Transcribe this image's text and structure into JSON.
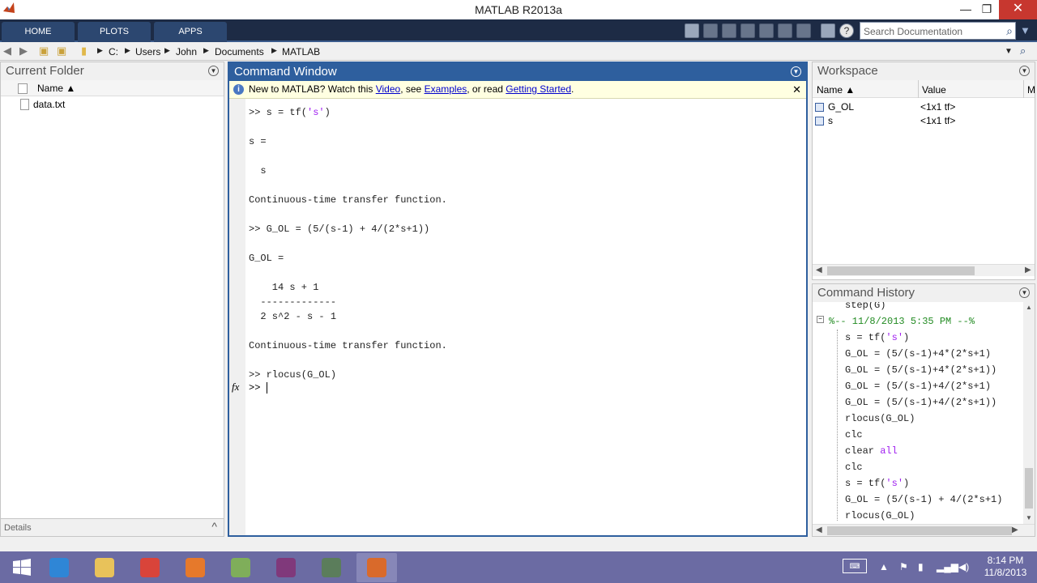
{
  "window": {
    "title": "MATLAB R2013a",
    "min": "—",
    "restore": "❐",
    "close": "✕"
  },
  "toolstrip": {
    "tabs": [
      "HOME",
      "PLOTS",
      "APPS"
    ],
    "search_placeholder": "Search Documentation",
    "accent": "#2e5f9e"
  },
  "address": {
    "path": [
      "C:",
      "Users",
      "John",
      "Documents",
      "MATLAB"
    ]
  },
  "current_folder": {
    "title": "Current Folder",
    "column": "Name ▲",
    "files": [
      "data.txt"
    ],
    "details_label": "Details"
  },
  "command_window": {
    "title": "Command Window",
    "banner": {
      "prefix": "New to MATLAB? Watch this ",
      "video": "Video",
      "mid": ", see ",
      "examples": "Examples",
      "mid2": ", or read ",
      "getting_started": "Getting Started",
      "suffix": "."
    },
    "lines": [
      {
        "pre": ">> s = tf(",
        "str": "'s'",
        "post": ")"
      },
      {
        "pre": "",
        "str": "",
        "post": ""
      },
      {
        "pre": "s =",
        "str": "",
        "post": ""
      },
      {
        "pre": "",
        "str": "",
        "post": ""
      },
      {
        "pre": "  s",
        "str": "",
        "post": ""
      },
      {
        "pre": "",
        "str": "",
        "post": ""
      },
      {
        "pre": "Continuous-time transfer function.",
        "str": "",
        "post": ""
      },
      {
        "pre": "",
        "str": "",
        "post": ""
      },
      {
        "pre": ">> G_OL = (5/(s-1) + 4/(2*s+1))",
        "str": "",
        "post": ""
      },
      {
        "pre": "",
        "str": "",
        "post": ""
      },
      {
        "pre": "G_OL =",
        "str": "",
        "post": ""
      },
      {
        "pre": "",
        "str": "",
        "post": ""
      },
      {
        "pre": "    14 s + 1",
        "str": "",
        "post": ""
      },
      {
        "pre": "  -------------",
        "str": "",
        "post": ""
      },
      {
        "pre": "  2 s^2 - s - 1",
        "str": "",
        "post": ""
      },
      {
        "pre": "",
        "str": "",
        "post": ""
      },
      {
        "pre": "Continuous-time transfer function.",
        "str": "",
        "post": ""
      },
      {
        "pre": "",
        "str": "",
        "post": ""
      },
      {
        "pre": ">> rlocus(G_OL)",
        "str": "",
        "post": ""
      }
    ],
    "prompt": ">> ",
    "fx": "fx"
  },
  "workspace": {
    "title": "Workspace",
    "columns": [
      "Name ▲",
      "Value",
      "M"
    ],
    "rows": [
      {
        "name": "G_OL",
        "value": "<1x1 tf>"
      },
      {
        "name": "s",
        "value": "<1x1 tf>"
      }
    ]
  },
  "history": {
    "title": "Command History",
    "entries": [
      {
        "pre": "step(G)",
        "hl": "",
        "post": ""
      },
      {
        "pre": "%-- 11/8/2013 5:35 PM --%",
        "hl": "",
        "post": "",
        "stamp": true
      },
      {
        "pre": "s = tf(",
        "hl": "'s'",
        "post": ")"
      },
      {
        "pre": "G_OL = (5/(s-1)+4*(2*s+1)",
        "hl": "",
        "post": ""
      },
      {
        "pre": "G_OL = (5/(s-1)+4*(2*s+1))",
        "hl": "",
        "post": ""
      },
      {
        "pre": "G_OL = (5/(s-1)+4/(2*s+1)",
        "hl": "",
        "post": ""
      },
      {
        "pre": "G_OL = (5/(s-1)+4/(2*s+1))",
        "hl": "",
        "post": ""
      },
      {
        "pre": "rlocus(G_OL)",
        "hl": "",
        "post": ""
      },
      {
        "pre": "clc",
        "hl": "",
        "post": ""
      },
      {
        "pre": "clear ",
        "hl": "all",
        "post": ""
      },
      {
        "pre": "clc",
        "hl": "",
        "post": ""
      },
      {
        "pre": "s = tf(",
        "hl": "'s'",
        "post": ")"
      },
      {
        "pre": "G_OL = (5/(s-1) + 4/(2*s+1)",
        "hl": "",
        "post": ""
      },
      {
        "pre": "rlocus(G_OL)",
        "hl": "",
        "post": ""
      }
    ]
  },
  "taskbar": {
    "time": "8:14 PM",
    "date": "11/8/2013",
    "apps": [
      {
        "name": "start",
        "color": "#ffffff"
      },
      {
        "name": "internet-explorer",
        "color": "#2f86d6"
      },
      {
        "name": "file-explorer",
        "color": "#e8c25a"
      },
      {
        "name": "chrome",
        "color": "#d9443a"
      },
      {
        "name": "firefox",
        "color": "#e6792b"
      },
      {
        "name": "notepad",
        "color": "#7fae5a"
      },
      {
        "name": "onenote",
        "color": "#80397b"
      },
      {
        "name": "snipping",
        "color": "#5b7d5b"
      },
      {
        "name": "matlab",
        "color": "#d96a2b"
      }
    ]
  }
}
